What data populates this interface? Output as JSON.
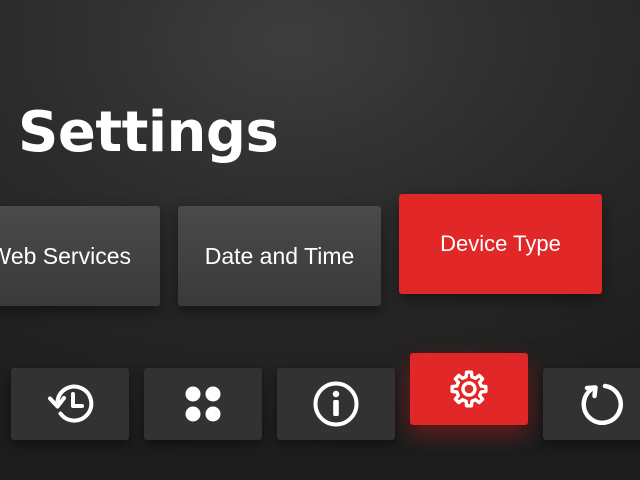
{
  "header": {
    "title": "Settings"
  },
  "menu": {
    "cards": [
      {
        "label": "Web Services",
        "selected": false
      },
      {
        "label": "Date and Time",
        "selected": false
      },
      {
        "label": "Device Type",
        "selected": true
      }
    ]
  },
  "toolbar": {
    "icons": [
      "history-icon",
      "apps-grid-icon",
      "info-icon",
      "settings-gear-icon",
      "refresh-icon"
    ],
    "selected": "settings-gear-icon"
  },
  "colors": {
    "accent": "#e12727",
    "card": "#424242",
    "tile": "#323232",
    "background": "#2a2a2a",
    "text": "#ffffff"
  }
}
